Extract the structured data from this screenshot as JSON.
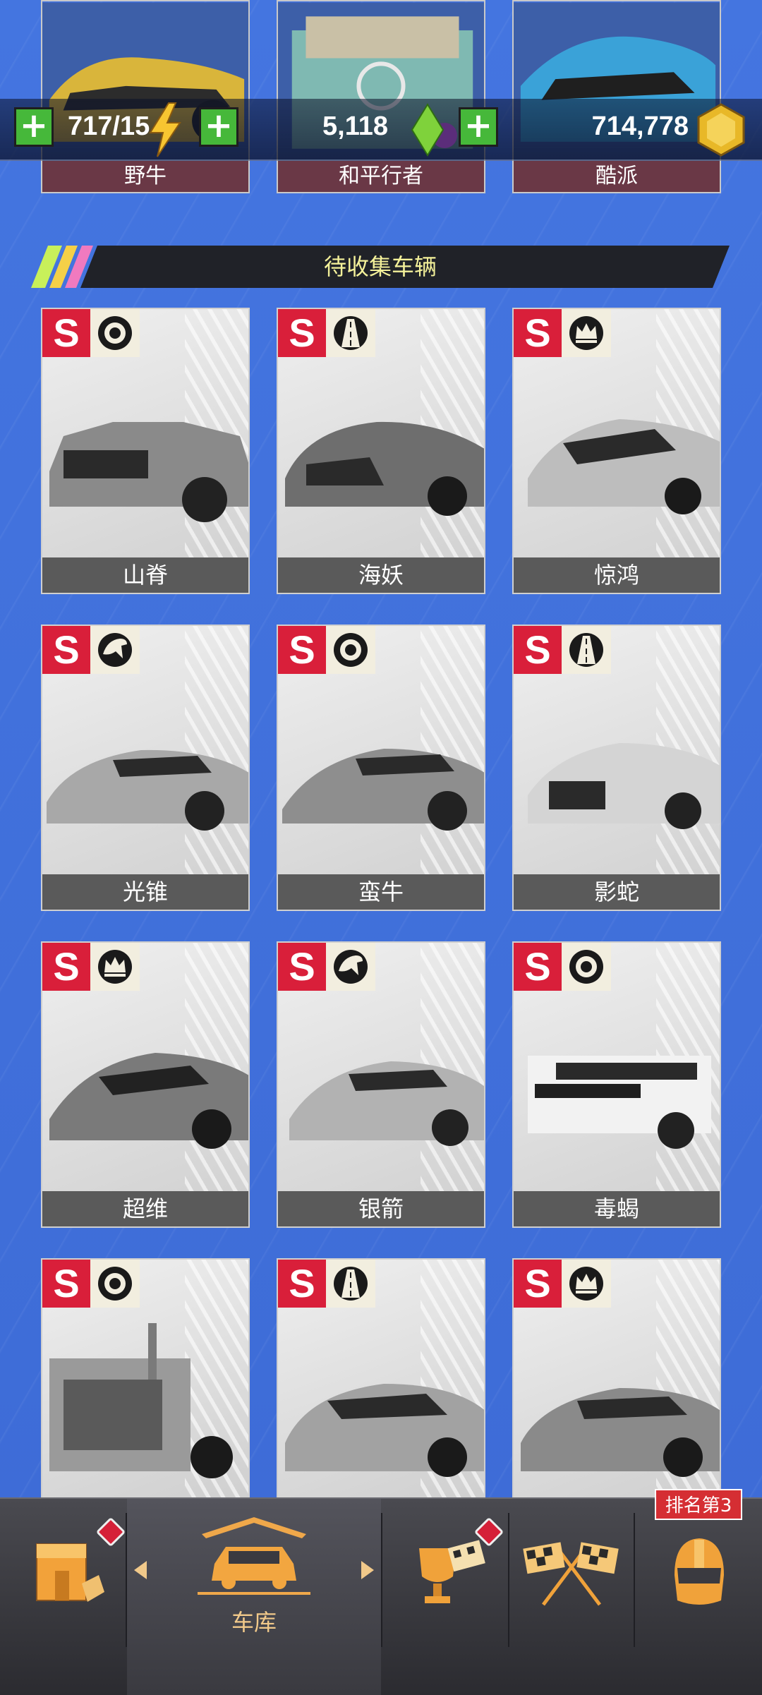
{
  "currency": {
    "energy": {
      "value": "717/15",
      "icon": "lightning-icon"
    },
    "gems": {
      "value": "5,118",
      "icon": "gem-icon"
    },
    "coins": {
      "value": "714,778",
      "icon": "coin-icon"
    }
  },
  "owned_cars": [
    {
      "name": "野牛"
    },
    {
      "name": "和平行者"
    },
    {
      "name": "酷派"
    }
  ],
  "section": {
    "title": "待收集车辆"
  },
  "cars": [
    {
      "name": "山脊",
      "rank": "S",
      "class_icon": "tire-icon"
    },
    {
      "name": "海妖",
      "rank": "S",
      "class_icon": "road-icon"
    },
    {
      "name": "惊鸿",
      "rank": "S",
      "class_icon": "crown-icon"
    },
    {
      "name": "光锥",
      "rank": "S",
      "class_icon": "horse-icon"
    },
    {
      "name": "蛮牛",
      "rank": "S",
      "class_icon": "tire-icon"
    },
    {
      "name": "影蛇",
      "rank": "S",
      "class_icon": "road-icon"
    },
    {
      "name": "超维",
      "rank": "S",
      "class_icon": "crown-icon"
    },
    {
      "name": "银箭",
      "rank": "S",
      "class_icon": "horse-icon"
    },
    {
      "name": "毒蝎",
      "rank": "S",
      "class_icon": "tire-icon"
    },
    {
      "name": "",
      "rank": "S",
      "class_icon": "tire-icon"
    },
    {
      "name": "",
      "rank": "S",
      "class_icon": "road-icon"
    },
    {
      "name": "",
      "rank": "S",
      "class_icon": "crown-icon"
    }
  ],
  "nav": {
    "garage_label": "车库",
    "rank_tag": "排名第3",
    "items": [
      "shop-icon",
      "garage-icon",
      "trophy-icon",
      "race-flags-icon",
      "helmet-icon"
    ]
  },
  "colors": {
    "background": "#3f6fd8",
    "rank_badge": "#d91f3a",
    "accent_label": "#f1c98a",
    "section_title": "#f4f19a"
  }
}
